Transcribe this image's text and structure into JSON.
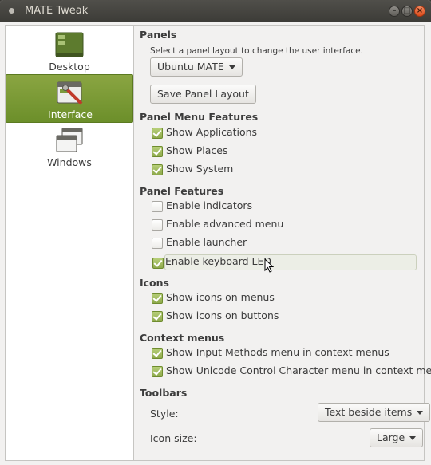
{
  "window": {
    "title": "MATE Tweak"
  },
  "sidebar": {
    "items": [
      {
        "label": "Desktop",
        "icon": "desktop-icon"
      },
      {
        "label": "Interface",
        "icon": "interface-icon",
        "selected": true
      },
      {
        "label": "Windows",
        "icon": "windows-icon"
      }
    ]
  },
  "panels": {
    "heading": "Panels",
    "hint": "Select a panel layout to change the user interface.",
    "layout_value": "Ubuntu MATE",
    "save_label": "Save Panel Layout"
  },
  "panel_menu_features": {
    "heading": "Panel Menu Features",
    "items": [
      {
        "label": "Show Applications",
        "checked": true
      },
      {
        "label": "Show Places",
        "checked": true
      },
      {
        "label": "Show System",
        "checked": true
      }
    ]
  },
  "panel_features": {
    "heading": "Panel Features",
    "items": [
      {
        "label": "Enable indicators",
        "checked": false
      },
      {
        "label": "Enable advanced menu",
        "checked": false
      },
      {
        "label": "Enable launcher",
        "checked": false
      },
      {
        "label": "Enable keyboard LED",
        "checked": true
      }
    ]
  },
  "icons": {
    "heading": "Icons",
    "items": [
      {
        "label": "Show icons on menus",
        "checked": true
      },
      {
        "label": "Show icons on buttons",
        "checked": true
      }
    ]
  },
  "context_menus": {
    "heading": "Context menus",
    "items": [
      {
        "label": "Show Input Methods menu in context menus",
        "checked": true
      },
      {
        "label": "Show Unicode Control Character menu in context menus",
        "checked": true
      }
    ]
  },
  "toolbars": {
    "heading": "Toolbars",
    "style_label": "Style:",
    "style_value": "Text beside items",
    "icon_size_label": "Icon size:",
    "icon_size_value": "Large"
  },
  "colors": {
    "accent": "#87a752",
    "titlebar": "#3c3b37",
    "close_button": "#e55b2b"
  }
}
